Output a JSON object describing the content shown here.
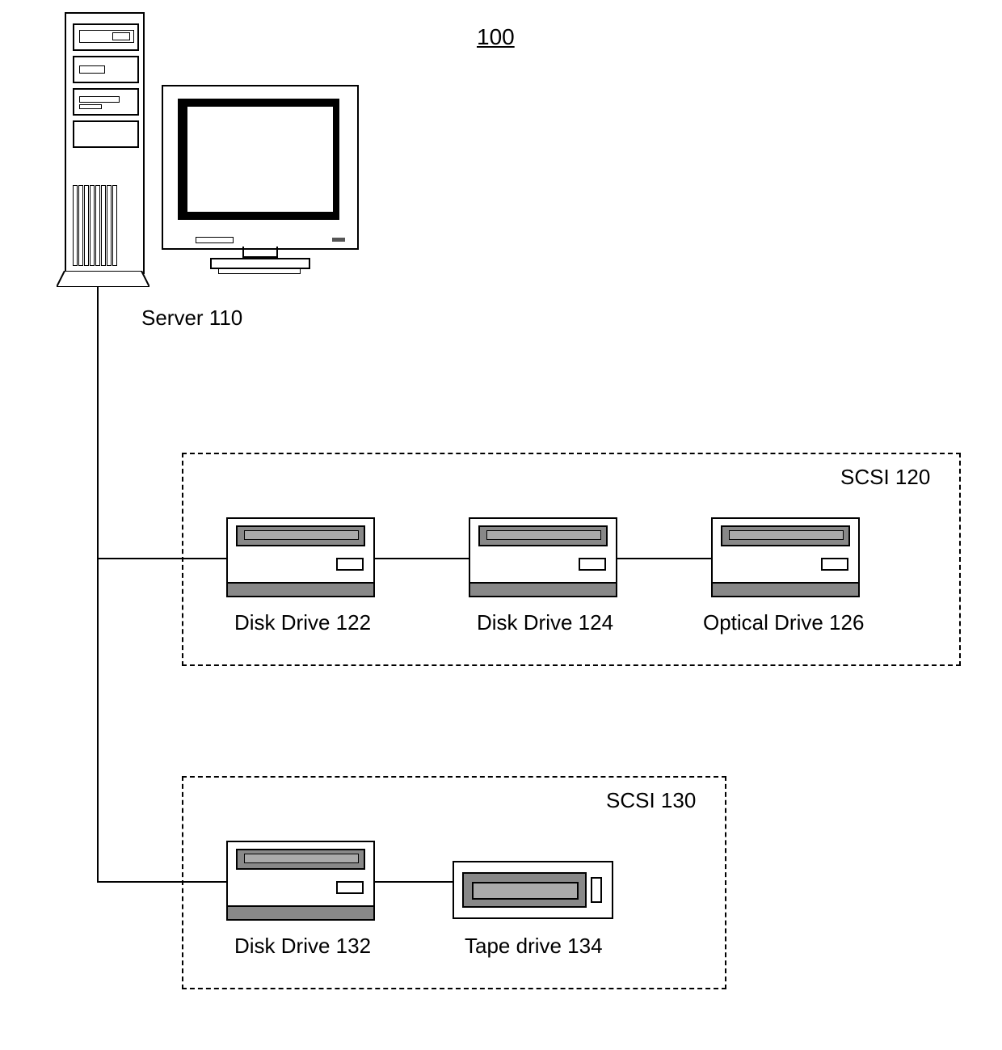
{
  "figure_number": "100",
  "server": {
    "label": "Server  110"
  },
  "bus1": {
    "label": "SCSI  120",
    "drives": [
      {
        "label": "Disk Drive 122"
      },
      {
        "label": "Disk Drive 124"
      },
      {
        "label": "Optical Drive 126"
      }
    ]
  },
  "bus2": {
    "label": "SCSI  130",
    "drives": [
      {
        "label": "Disk Drive 132"
      },
      {
        "label": "Tape drive 134"
      }
    ]
  }
}
